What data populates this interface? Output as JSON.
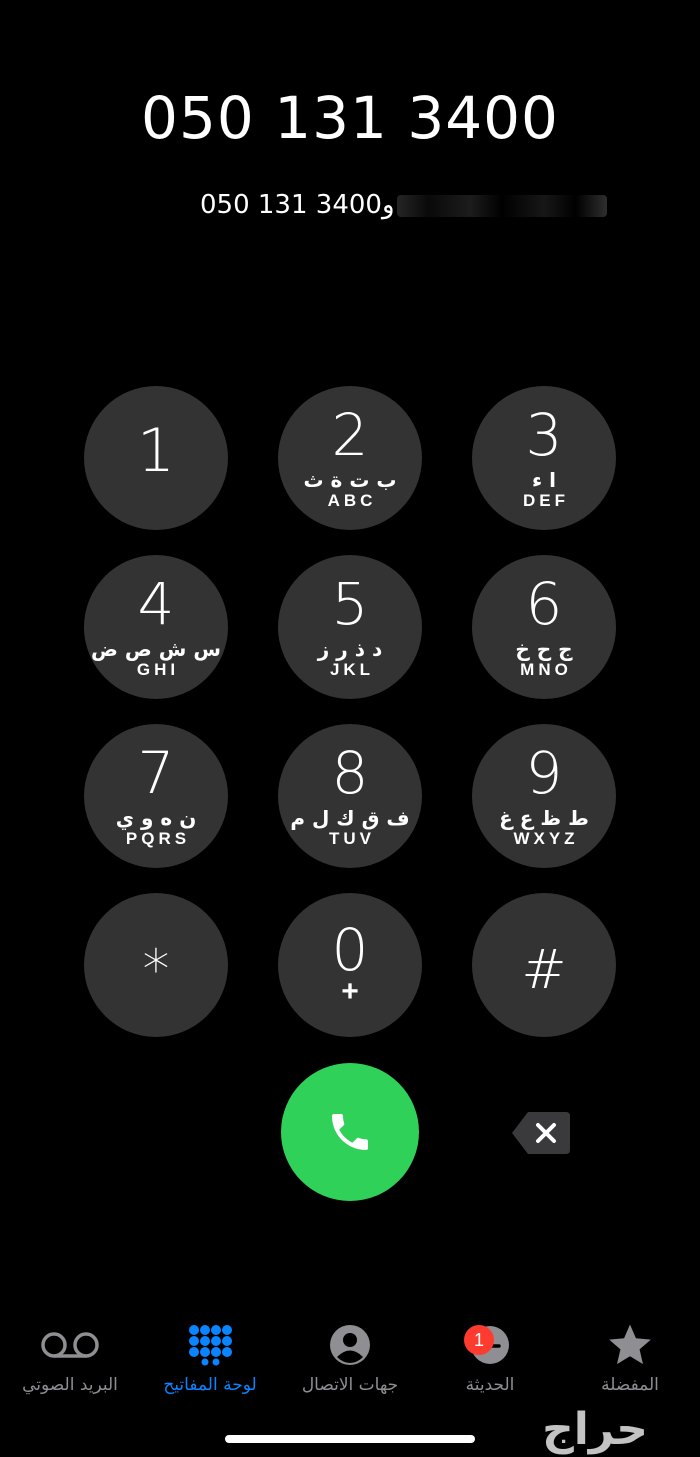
{
  "dialer": {
    "number": "050 131 3400",
    "subline_number": "050 131 3400",
    "subline_suffix": "و"
  },
  "keypad": [
    {
      "digit": "1",
      "arabic": "",
      "letters": ""
    },
    {
      "digit": "2",
      "arabic": "ب ت ة ث",
      "letters": "ABC"
    },
    {
      "digit": "3",
      "arabic": "ا ء",
      "letters": "DEF"
    },
    {
      "digit": "4",
      "arabic": "س ش ص ض",
      "letters": "GHI"
    },
    {
      "digit": "5",
      "arabic": "د ذ ر ز",
      "letters": "JKL"
    },
    {
      "digit": "6",
      "arabic": "ج ح خ",
      "letters": "MNO"
    },
    {
      "digit": "7",
      "arabic": "ن ه و ي",
      "letters": "PQRS"
    },
    {
      "digit": "8",
      "arabic": "ف ق ك ل م",
      "letters": "TUV"
    },
    {
      "digit": "9",
      "arabic": "ط ظ ع غ",
      "letters": "WXYZ"
    },
    {
      "digit": "*",
      "arabic": "",
      "letters": ""
    },
    {
      "digit": "0",
      "arabic": "",
      "letters": "+"
    },
    {
      "digit": "#",
      "arabic": "",
      "letters": ""
    }
  ],
  "colors": {
    "call": "#30d158",
    "key": "#333333",
    "active_tab": "#0a84ff",
    "badge": "#ff3b30"
  },
  "tabs": [
    {
      "label": "البريد الصوتي",
      "icon": "voicemail-icon"
    },
    {
      "label": "لوحة المفاتيح",
      "icon": "keypad-icon",
      "active": true
    },
    {
      "label": "جهات الاتصال",
      "icon": "contacts-icon"
    },
    {
      "label": "الحديثة",
      "icon": "clock-icon",
      "badge": "1"
    },
    {
      "label": "المفضلة",
      "icon": "star-icon"
    }
  ],
  "watermark": "حراج"
}
